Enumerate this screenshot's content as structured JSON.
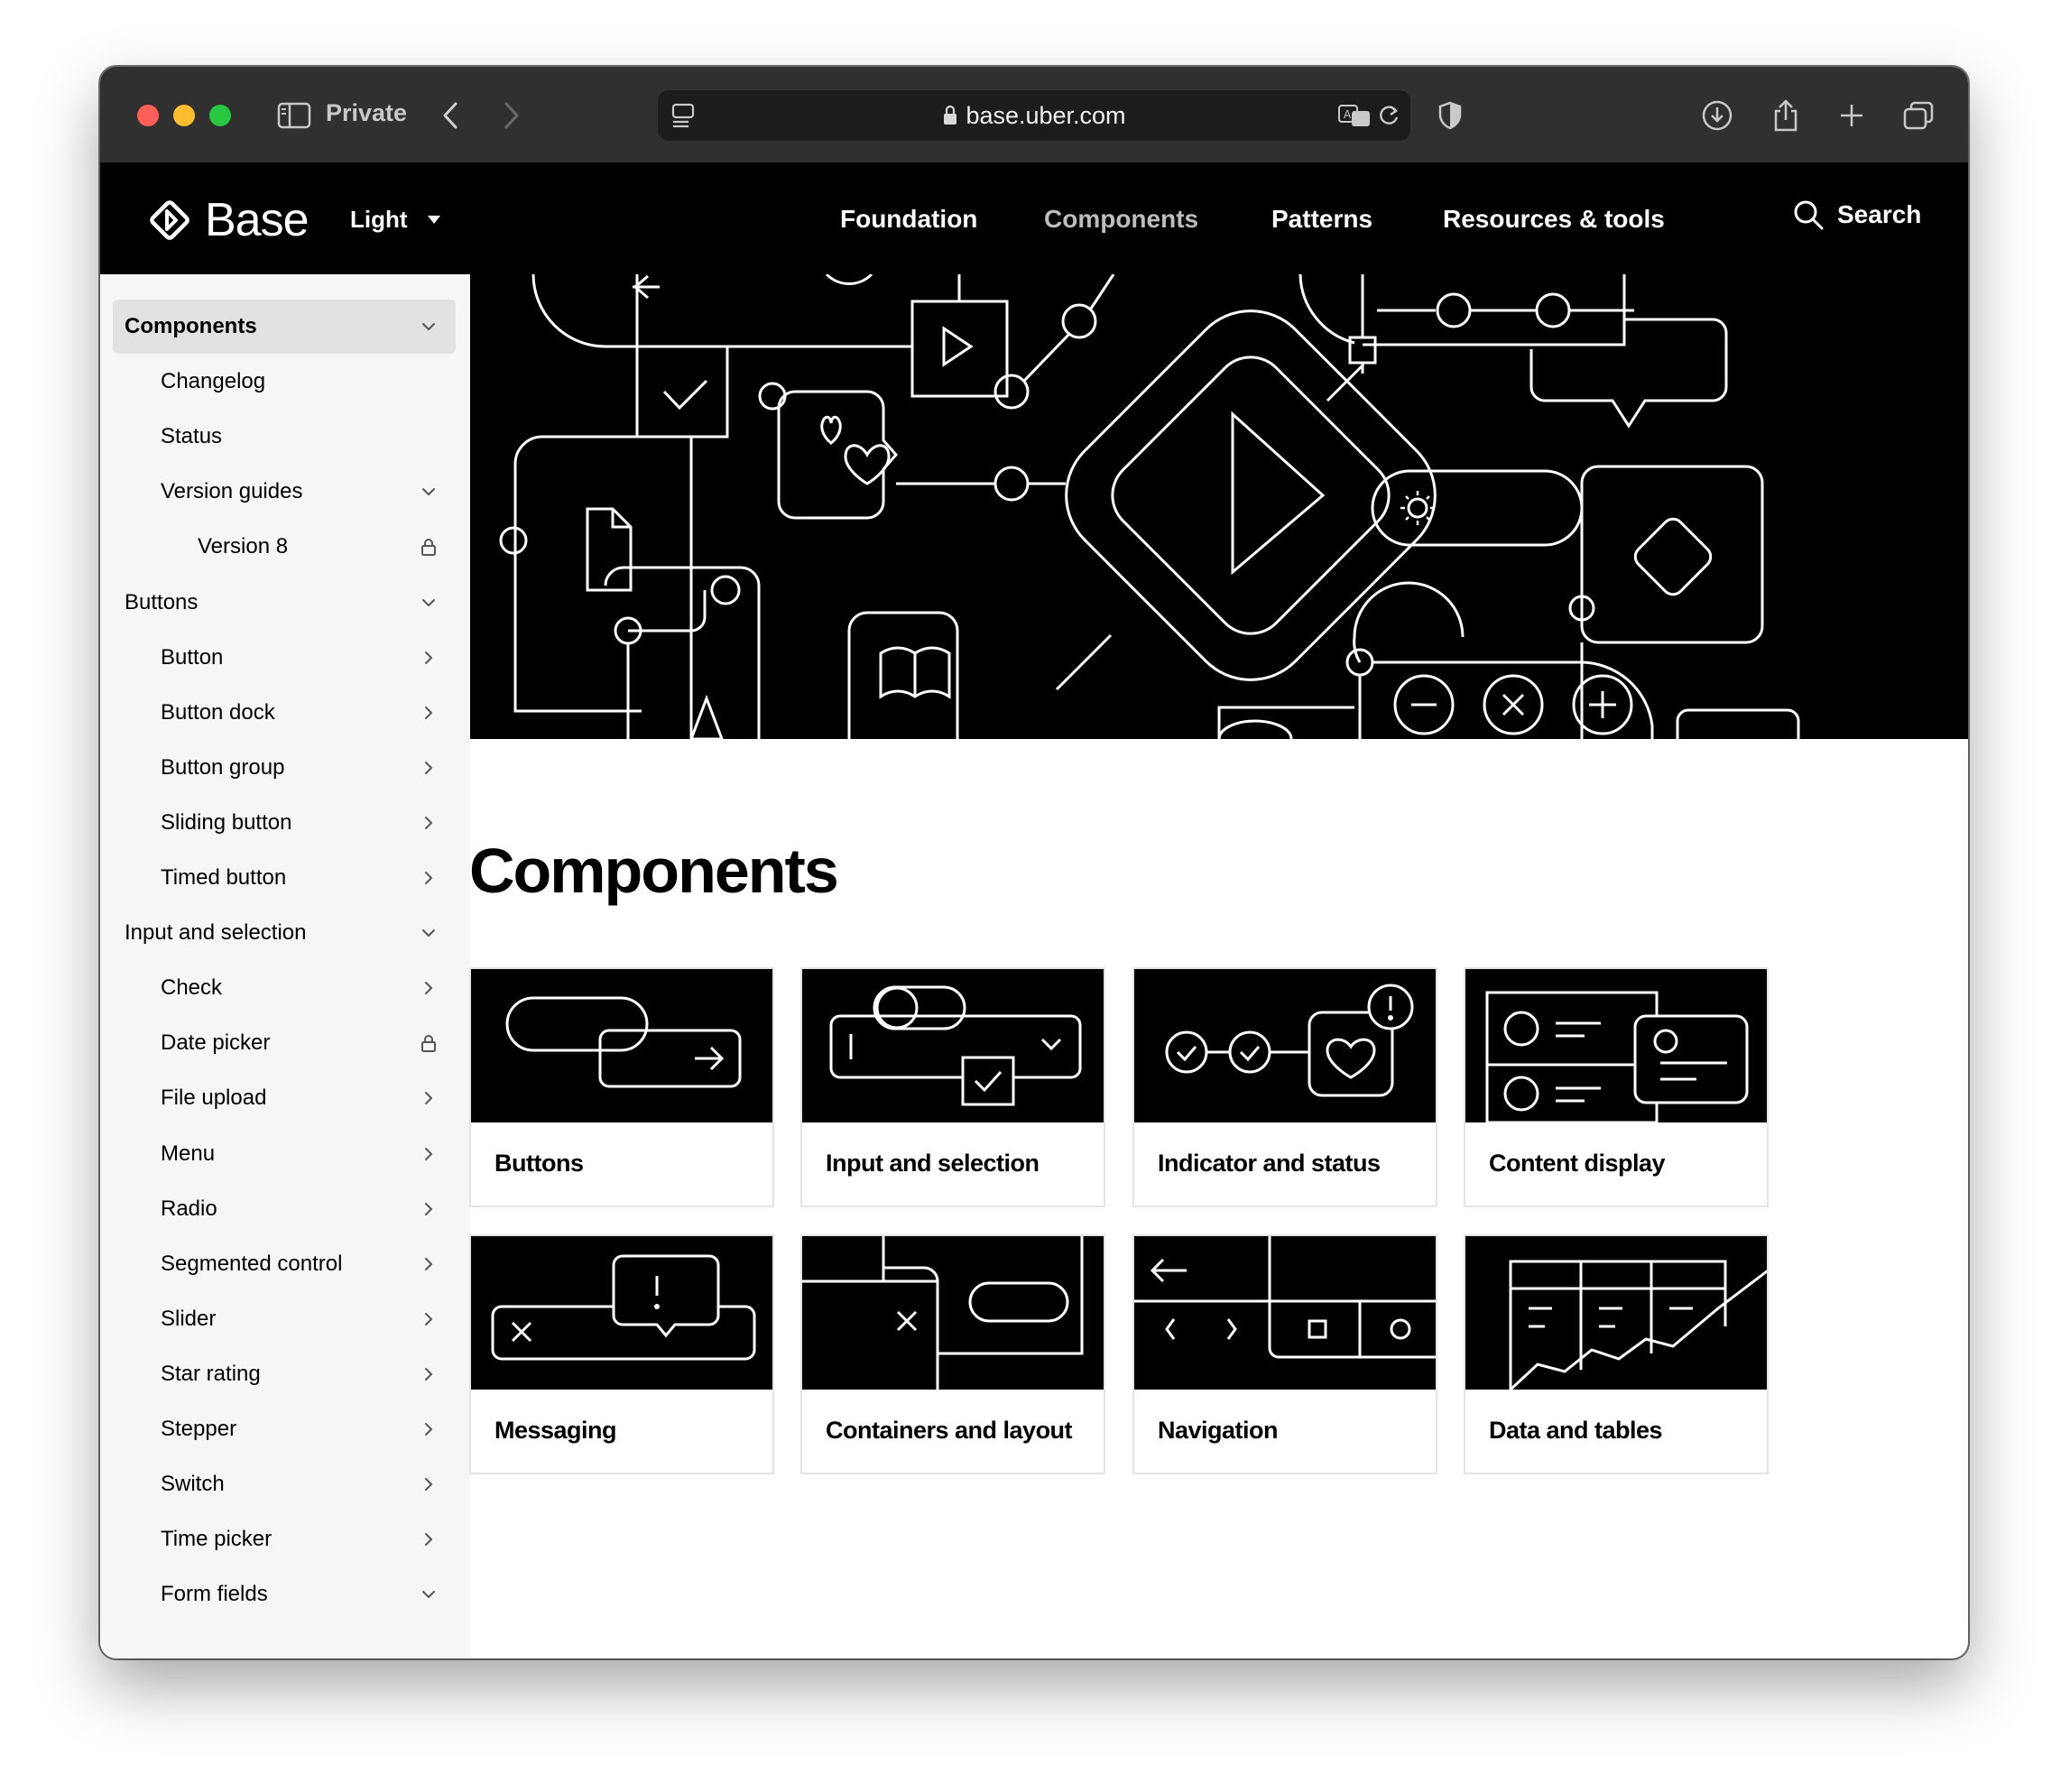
{
  "browser": {
    "private_label": "Private",
    "url": "base.uber.com"
  },
  "header": {
    "logo_text": "Base",
    "theme_select": "Light",
    "nav": [
      "Foundation",
      "Components",
      "Patterns",
      "Resources & tools"
    ],
    "active_nav": "Components",
    "search_label": "Search"
  },
  "sidebar": {
    "items": [
      {
        "label": "Components",
        "level": 0,
        "icon": "chevron-down-icon",
        "selected": true
      },
      {
        "label": "Changelog",
        "level": 1,
        "icon": ""
      },
      {
        "label": "Status",
        "level": 1,
        "icon": ""
      },
      {
        "label": "Version guides",
        "level": 1,
        "icon": "chevron-down-icon"
      },
      {
        "label": "Version 8",
        "level": 2,
        "icon": "lock-icon"
      },
      {
        "label": "Buttons",
        "level": 0,
        "icon": "chevron-down-icon"
      },
      {
        "label": "Button",
        "level": 1,
        "icon": "chevron-right-icon"
      },
      {
        "label": "Button dock",
        "level": 1,
        "icon": "chevron-right-icon"
      },
      {
        "label": "Button group",
        "level": 1,
        "icon": "chevron-right-icon"
      },
      {
        "label": "Sliding button",
        "level": 1,
        "icon": "chevron-right-icon"
      },
      {
        "label": "Timed button",
        "level": 1,
        "icon": "chevron-right-icon"
      },
      {
        "label": "Input and selection",
        "level": 0,
        "icon": "chevron-down-icon"
      },
      {
        "label": "Check",
        "level": 1,
        "icon": "chevron-right-icon"
      },
      {
        "label": "Date picker",
        "level": 1,
        "icon": "lock-icon"
      },
      {
        "label": "File upload",
        "level": 1,
        "icon": "chevron-right-icon"
      },
      {
        "label": "Menu",
        "level": 1,
        "icon": "chevron-right-icon"
      },
      {
        "label": "Radio",
        "level": 1,
        "icon": "chevron-right-icon"
      },
      {
        "label": "Segmented control",
        "level": 1,
        "icon": "chevron-right-icon"
      },
      {
        "label": "Slider",
        "level": 1,
        "icon": "chevron-right-icon"
      },
      {
        "label": "Star rating",
        "level": 1,
        "icon": "chevron-right-icon"
      },
      {
        "label": "Stepper",
        "level": 1,
        "icon": "chevron-right-icon"
      },
      {
        "label": "Switch",
        "level": 1,
        "icon": "chevron-right-icon"
      },
      {
        "label": "Time picker",
        "level": 1,
        "icon": "chevron-right-icon"
      },
      {
        "label": "Form fields",
        "level": 1,
        "icon": "chevron-down-icon"
      }
    ]
  },
  "main": {
    "title": "Components",
    "cards": [
      {
        "label": "Buttons"
      },
      {
        "label": "Input and selection"
      },
      {
        "label": "Indicator and status"
      },
      {
        "label": "Content display"
      },
      {
        "label": "Messaging"
      },
      {
        "label": "Containers and layout"
      },
      {
        "label": "Navigation"
      },
      {
        "label": "Data and tables"
      }
    ]
  },
  "colors": {
    "header_bg": "#000000",
    "toolbar_bg": "#303030",
    "sidebar_bg": "#f6f6f6",
    "selected_bg": "#e2e2e2",
    "active_nav": "#bdbdbd"
  }
}
